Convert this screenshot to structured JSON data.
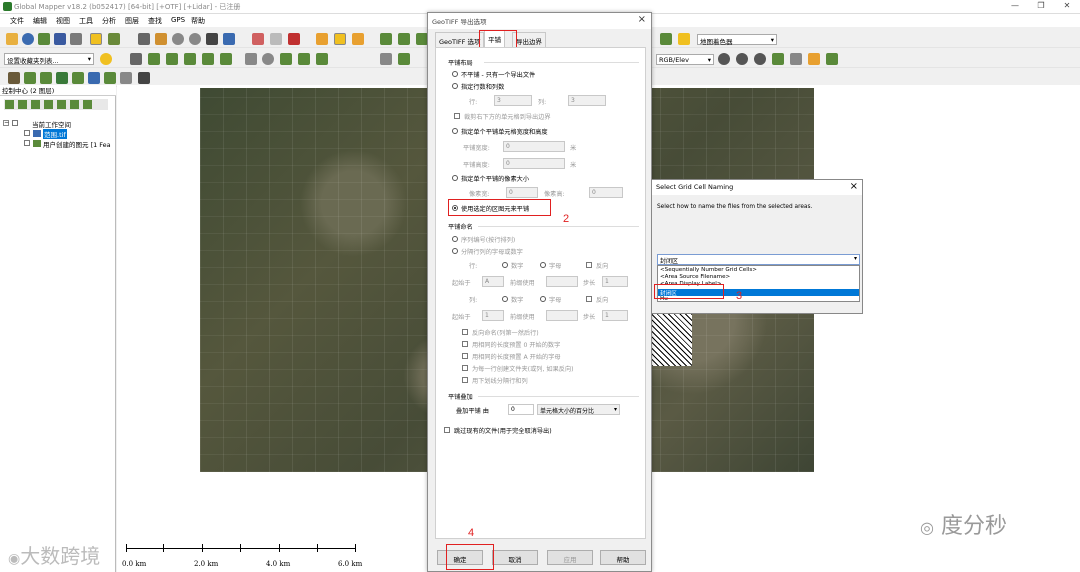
{
  "window": {
    "title": "Global Mapper v18.2 (b052417) [64-bit] [+OTF] [+Lidar] - 已注册"
  },
  "menubar": [
    "文件",
    "编辑",
    "视图",
    "工具",
    "分析",
    "图层",
    "查找",
    "GPS",
    "帮助"
  ],
  "toolbar": {
    "favorites_placeholder": "设置收藏夹列表...",
    "shader_label": "地图着色器",
    "elev_label": "RGB/Elev"
  },
  "control_center": {
    "title": "控制中心 (2 图层)",
    "root": "当前工作空间",
    "layers": [
      "范围.tif",
      "用户创建的图元 [1 Fea"
    ]
  },
  "scalebar": {
    "labels": [
      "0.0 km",
      "2.0 km",
      "4.0 km",
      "6.0 km"
    ]
  },
  "dialog": {
    "title": "GeoTIFF 导出选项",
    "tabs": [
      "GeoTIFF 选项",
      "平铺",
      "导出边界"
    ],
    "section_layout": "平铺布局",
    "opt_no_tile": "不平铺 - 只有一个导出文件",
    "opt_rows_cols": "指定行数和列数",
    "rows_label": "行:",
    "rows_value": "3",
    "cols_label": "列:",
    "cols_value": "3",
    "crop_bottom_right": "裁剪右下方的单元格到导出边界",
    "opt_cell_size": "指定单个平铺单元格宽度和高度",
    "tile_width_label": "平铺宽度:",
    "tile_width_value": "0",
    "tile_height_label": "平铺高度:",
    "tile_height_value": "0",
    "unit_m": "米",
    "opt_pixel_size": "指定单个平铺的像素大小",
    "px_width_label": "像素宽:",
    "px_width_value": "0",
    "px_height_label": "像素高:",
    "px_height_value": "0",
    "opt_area_features": "使用选定的区图元来平铺",
    "section_naming": "平铺命名",
    "opt_sequence": "序列编号(按行排列)",
    "opt_separate": "分隔行列的字母或数字",
    "row_label": "行:",
    "col_label": "列:",
    "numeric": "数字",
    "letter": "字母",
    "reverse": "反向",
    "start_label": "起始于",
    "start_row_value": "A",
    "start_col_value": "1",
    "prefix_label": "前缀使用",
    "step_label": "步长",
    "step_value": "1",
    "opts": [
      "反向命名(列第一然后行)",
      "用相同的长度预置 0 开始的数字",
      "用相同的长度预置 A 开始的字母",
      "为每一行创建文件夹(或列, 如果反向)",
      "用下划线分隔行和列"
    ],
    "section_overlap": "平铺叠加",
    "overlap_label": "叠加平铺 由",
    "overlap_value": "0",
    "overlap_unit": "单元格大小的百分比",
    "skip_existing": "跳过现有的文件(用于完全取消导出)",
    "buttons": {
      "ok": "确定",
      "cancel": "取消",
      "apply": "应用",
      "help": "帮助"
    }
  },
  "grid_dialog": {
    "title": "Select Grid Cell Naming",
    "description": "Select how to name the files from the selected areas.",
    "selected": "封闭区",
    "options": [
      "<Sequentially Number Grid Cells>",
      "<Area Source Filename>",
      "<Area Display Label>",
      "封闭区",
      "Hu"
    ]
  },
  "annotations": [
    "1",
    "2",
    "3",
    "4"
  ],
  "watermarks": {
    "right": "度分秒",
    "left": "大数跨境"
  }
}
